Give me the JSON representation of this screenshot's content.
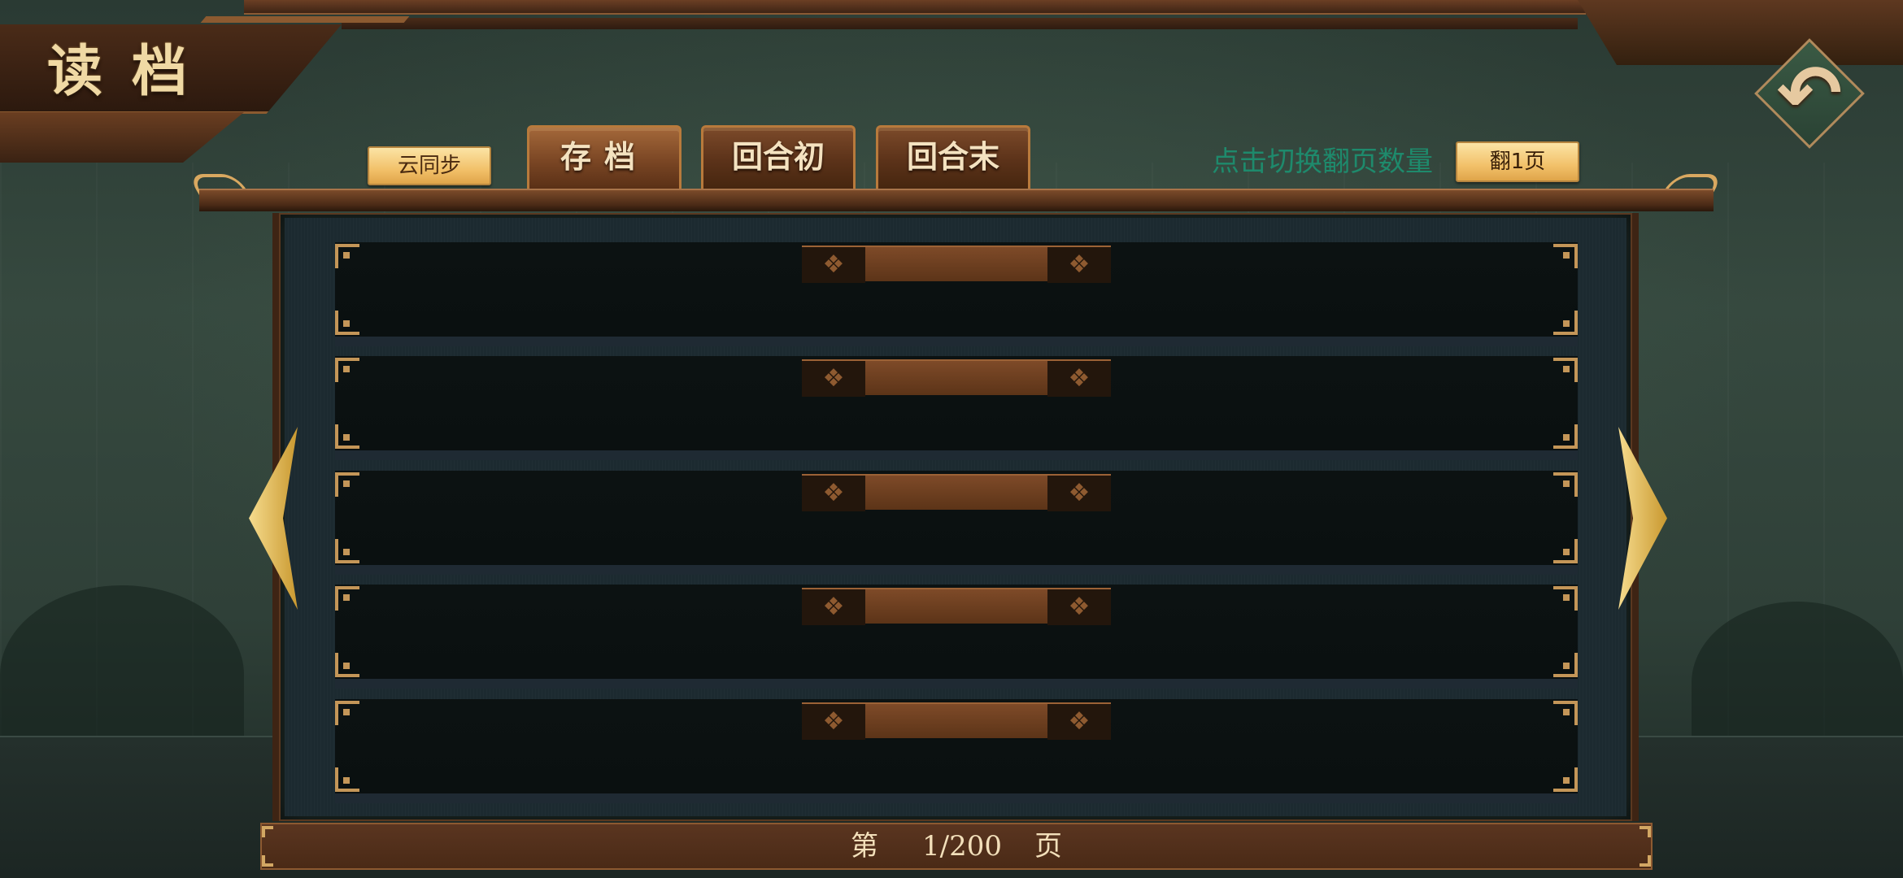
{
  "title": "读档",
  "toolbar": {
    "cloud_sync_label": "云同步",
    "page_flip_prompt": "点击切换翻页数量",
    "page_flip_button": "翻1页"
  },
  "tabs": [
    {
      "label": "存档",
      "active": true
    },
    {
      "label": "回合初",
      "active": false
    },
    {
      "label": "回合末",
      "active": false
    }
  ],
  "save_slots": [
    {
      "title": ""
    },
    {
      "title": ""
    },
    {
      "title": ""
    },
    {
      "title": ""
    },
    {
      "title": ""
    }
  ],
  "pagination": {
    "prefix": "第",
    "current": "1/200",
    "suffix": "页"
  },
  "colors": {
    "accent_gold": "#f2c16a",
    "wood_brown": "#5b3219",
    "prompt_green": "#1e8a6c",
    "title_text": "#f0d9a4"
  },
  "icons": {
    "back": "back-arrow-icon",
    "prev": "chevron-left-icon",
    "next": "chevron-right-icon"
  }
}
